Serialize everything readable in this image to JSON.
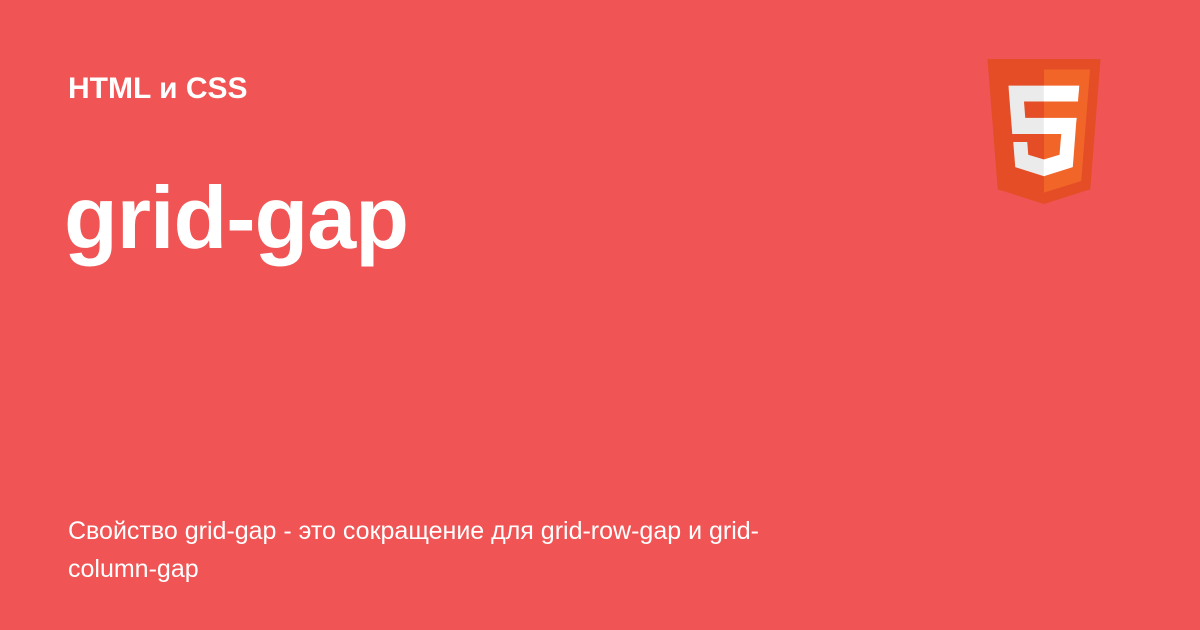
{
  "category": "HTML и CSS",
  "title": "grid-gap",
  "description": "Свойство grid-gap - это сокращение для grid-row-gap и grid-column-gap",
  "logo": {
    "icon": "html5-logo-icon",
    "glyph": "5"
  },
  "colors": {
    "background": "#F05454",
    "text": "#FFFFFF",
    "logo_dark": "#E44D26",
    "logo_light": "#F16529",
    "logo_glyph": "#EBEBEB"
  }
}
